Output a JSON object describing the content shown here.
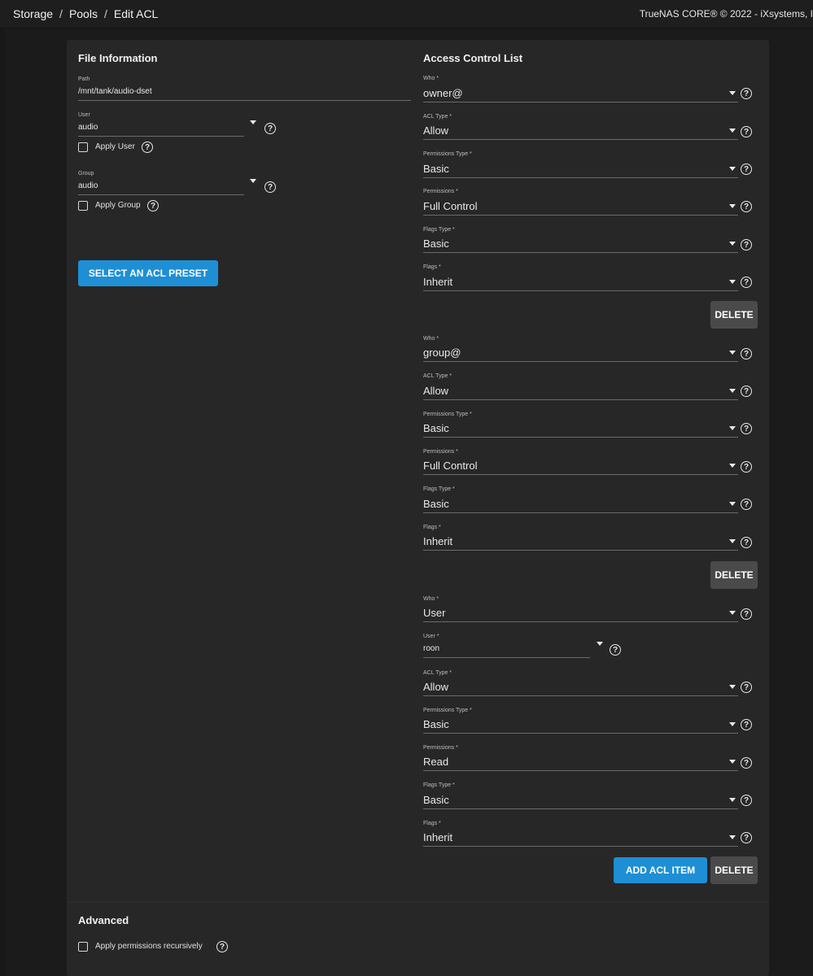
{
  "breadcrumb": [
    "Storage",
    "Pools",
    "Edit ACL"
  ],
  "breadcrumb_sep": "/",
  "copyright": "TrueNAS CORE® © 2022 - iXsystems, I",
  "help_glyph": "?",
  "file_info": {
    "title": "File Information",
    "path_label": "Path",
    "path_value": "/mnt/tank/audio-dset",
    "user_label": "User",
    "user_value": "audio",
    "apply_user_label": "Apply User",
    "group_label": "Group",
    "group_value": "audio",
    "apply_group_label": "Apply Group",
    "preset_button": "SELECT AN ACL PRESET"
  },
  "acl": {
    "title": "Access Control List",
    "entries": [
      {
        "fields": [
          {
            "label": "Who *",
            "value": "owner@"
          },
          {
            "label": "ACL Type *",
            "value": "Allow"
          },
          {
            "label": "Permissions Type *",
            "value": "Basic"
          },
          {
            "label": "Permissions *",
            "value": "Full Control"
          },
          {
            "label": "Flags Type *",
            "value": "Basic"
          },
          {
            "label": "Flags *",
            "value": "Inherit"
          }
        ],
        "delete_label": "DELETE"
      },
      {
        "fields": [
          {
            "label": "Who *",
            "value": "group@"
          },
          {
            "label": "ACL Type *",
            "value": "Allow"
          },
          {
            "label": "Permissions Type *",
            "value": "Basic"
          },
          {
            "label": "Permissions *",
            "value": "Full Control"
          },
          {
            "label": "Flags Type *",
            "value": "Basic"
          },
          {
            "label": "Flags *",
            "value": "Inherit"
          }
        ],
        "delete_label": "DELETE"
      },
      {
        "fields": [
          {
            "label": "Who *",
            "value": "User"
          },
          {
            "label": "User *",
            "value": "roon"
          },
          {
            "label": "ACL Type *",
            "value": "Allow"
          },
          {
            "label": "Permissions Type *",
            "value": "Basic"
          },
          {
            "label": "Permissions *",
            "value": "Read"
          },
          {
            "label": "Flags Type *",
            "value": "Basic"
          },
          {
            "label": "Flags *",
            "value": "Inherit"
          }
        ],
        "delete_label": "DELETE"
      }
    ],
    "add_button": "ADD ACL ITEM"
  },
  "advanced": {
    "title": "Advanced",
    "recursive_label": "Apply permissions recursively"
  }
}
